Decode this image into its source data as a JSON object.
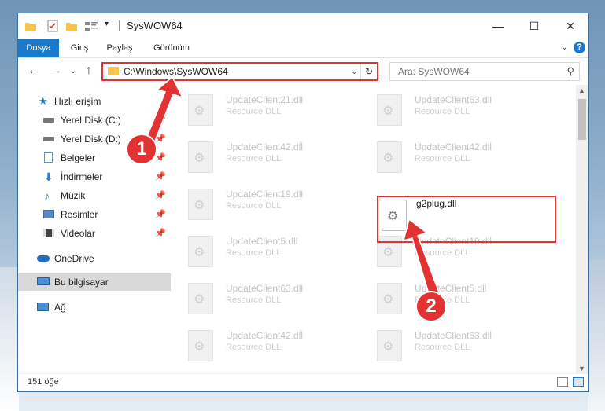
{
  "window": {
    "title": "SysWOW64",
    "controls": {
      "minimize": "—",
      "maximize": "☐",
      "close": "✕"
    }
  },
  "ribbon": {
    "tabs": [
      "Dosya",
      "Giriş",
      "Paylaş",
      "Görünüm"
    ],
    "help": "?"
  },
  "navigation": {
    "address": "C:\\Windows\\SysWOW64",
    "search_placeholder": "Ara: SysWOW64"
  },
  "sidebar": {
    "items": [
      {
        "label": "Hızlı erişim",
        "icon": "star-icon",
        "pinned": false
      },
      {
        "label": "Yerel Disk (C:)",
        "icon": "drive-icon",
        "pinned": true
      },
      {
        "label": "Yerel Disk (D:)",
        "icon": "drive-icon",
        "pinned": true
      },
      {
        "label": "Belgeler",
        "icon": "documents-icon",
        "pinned": true
      },
      {
        "label": "İndirmeler",
        "icon": "download-icon",
        "pinned": true
      },
      {
        "label": "Müzik",
        "icon": "music-icon",
        "pinned": true
      },
      {
        "label": "Resimler",
        "icon": "pictures-icon",
        "pinned": true
      },
      {
        "label": "Videolar",
        "icon": "video-icon",
        "pinned": true
      },
      {
        "label": "OneDrive",
        "icon": "cloud-icon",
        "pinned": false
      },
      {
        "label": "Bu bilgisayar",
        "icon": "computer-icon",
        "pinned": false,
        "selected": true
      },
      {
        "label": "Ağ",
        "icon": "network-icon",
        "pinned": false
      }
    ]
  },
  "files": [
    {
      "name": "UpdateClient21.dll",
      "type": "Resource DLL"
    },
    {
      "name": "UpdateClient63.dll",
      "type": "Resource DLL"
    },
    {
      "name": "UpdateClient42.dll",
      "type": "Resource DLL"
    },
    {
      "name": "UpdateClient42.dll",
      "type": "Resource DLL"
    },
    {
      "name": "UpdateClient19.dll",
      "type": "Resource DLL"
    },
    {
      "name": "g2plug.dll",
      "type": ""
    },
    {
      "name": "UpdateClient5.dll",
      "type": "Resource DLL"
    },
    {
      "name": "UpdateClient19.dll",
      "type": "Resource DLL"
    },
    {
      "name": "UpdateClient63.dll",
      "type": "Resource DLL"
    },
    {
      "name": "UpdateClient5.dll",
      "type": "Resource DLL"
    },
    {
      "name": "UpdateClient42.dll",
      "type": "Resource DLL"
    },
    {
      "name": "UpdateClient63.dll",
      "type": "Resource DLL"
    }
  ],
  "status": {
    "item_count": "151 öğe"
  },
  "callouts": [
    "1",
    "2"
  ],
  "colors": {
    "accent": "#1979ca",
    "highlight": "#e23232"
  }
}
